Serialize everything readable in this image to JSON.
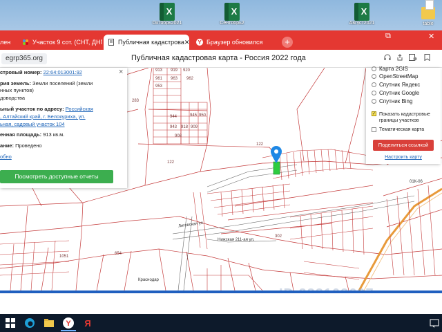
{
  "desktop": {
    "icons": [
      {
        "label": "Октябрь2021",
        "type": "excel"
      },
      {
        "label": "Сентябрь2",
        "type": "excel"
      },
      {
        "label": "Август2021",
        "type": "excel"
      },
      {
        "label": "table",
        "type": "folder"
      }
    ]
  },
  "browser": {
    "tabs": [
      {
        "label": "лен",
        "active": false
      },
      {
        "label": "Участок 9 сот. (СНТ, ДНП)",
        "active": false
      },
      {
        "label": "Публичная кадастрова",
        "active": true
      },
      {
        "label": "Браузер обновился",
        "active": false
      }
    ],
    "new_tab": "+",
    "domain": "egrp365.org",
    "page_title": "Публичная кадастровая карта - Россия 2022 года",
    "window_controls": [
      "⧉",
      "✕"
    ]
  },
  "info_panel": {
    "cadastral_label": "стровый номер:",
    "cadastral_number": "22:64:013001:92",
    "category_label": "рия земель:",
    "category_value": "Земли поселений (земли",
    "category_value_2": "нных пунктов)",
    "usage_value": "доводства",
    "address_label": "ьный участок по адресу:",
    "address_link_1": "Российская",
    "address_link_2": ", Алтайский край, г. Белокуриха, ул.",
    "address_link_3": "ьная, садовый участок 104",
    "area_label": "енная площадь:",
    "area_value": "913 кв.м.",
    "status_label": "ание:",
    "status_value": "Проведено",
    "more_link": "обно",
    "report_button": "Посмотреть доступные отчеты",
    "close": "×"
  },
  "layer_panel": {
    "options": [
      {
        "label": "Карта 2GIS",
        "kind": "radio"
      },
      {
        "label": "OpenStreetMap",
        "kind": "radio"
      },
      {
        "label": "Спутник Яндекс",
        "kind": "radio"
      },
      {
        "label": "Спутник Google",
        "kind": "radio"
      },
      {
        "label": "Спутник Bing",
        "kind": "radio"
      }
    ],
    "show_borders_1": "Показать кадастровые",
    "show_borders_2": "границы участков",
    "thematic_map": "Тематическая карта",
    "share_button": "Поделиться ссылкой",
    "setup_link": "Настроить карту"
  },
  "map": {
    "parcel_labels": [
      "913",
      "919",
      "920",
      "961",
      "953",
      "963",
      "962",
      "944",
      "945",
      "950",
      "943",
      "918",
      "909",
      "908",
      "283",
      "122",
      "122",
      "1051",
      "654",
      "302"
    ],
    "road_labels": [
      "Лиговская ул.",
      "Нижская 211-ая ул.",
      "Краснодар"
    ],
    "highway_label": "01К-06",
    "checkmark": "✓"
  },
  "watermark": "ID 233103607",
  "colors": {
    "tab_bar": "#e43832",
    "map_lines": "#c43a3a",
    "report_button": "#3cae4f",
    "share_button": "#d9403a",
    "marker": "#1e88e5",
    "selected_parcel": "#2ecc40"
  }
}
